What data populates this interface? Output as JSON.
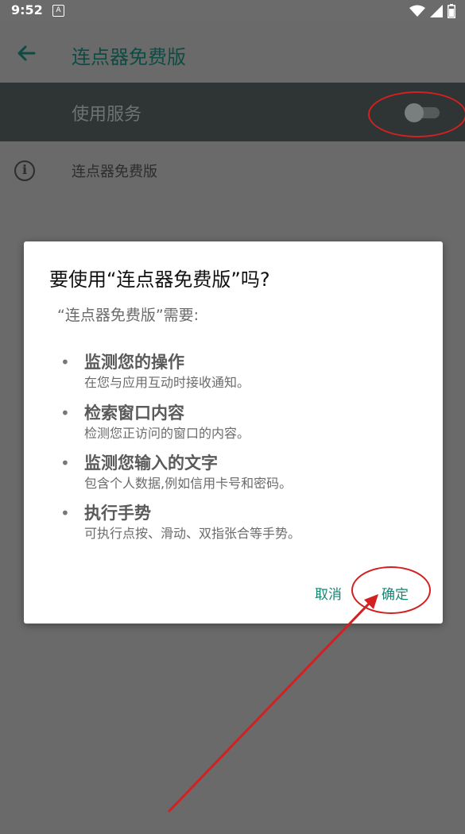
{
  "status_bar": {
    "time": "9:52",
    "notif_letter": "A"
  },
  "app_bar": {
    "title": "连点器免费版"
  },
  "service": {
    "label": "使用服务"
  },
  "info": {
    "text": "连点器免费版"
  },
  "dialog": {
    "title": "要使用“连点器免费版”吗?",
    "subtitle": "“连点器免费版”需要:",
    "permissions": [
      {
        "title": "监测您的操作",
        "desc": "在您与应用互动时接收通知。"
      },
      {
        "title": "检索窗口内容",
        "desc": "检测您正访问的窗口的内容。"
      },
      {
        "title": "监测您输入的文字",
        "desc": "包含个人数据,例如信用卡号和密码。"
      },
      {
        "title": "执行手势",
        "desc": "可执行点按、滑动、双指张合等手势。"
      }
    ],
    "cancel_label": "取消",
    "ok_label": "确定"
  },
  "colors": {
    "accent": "#128774",
    "annotation": "#d32020"
  }
}
